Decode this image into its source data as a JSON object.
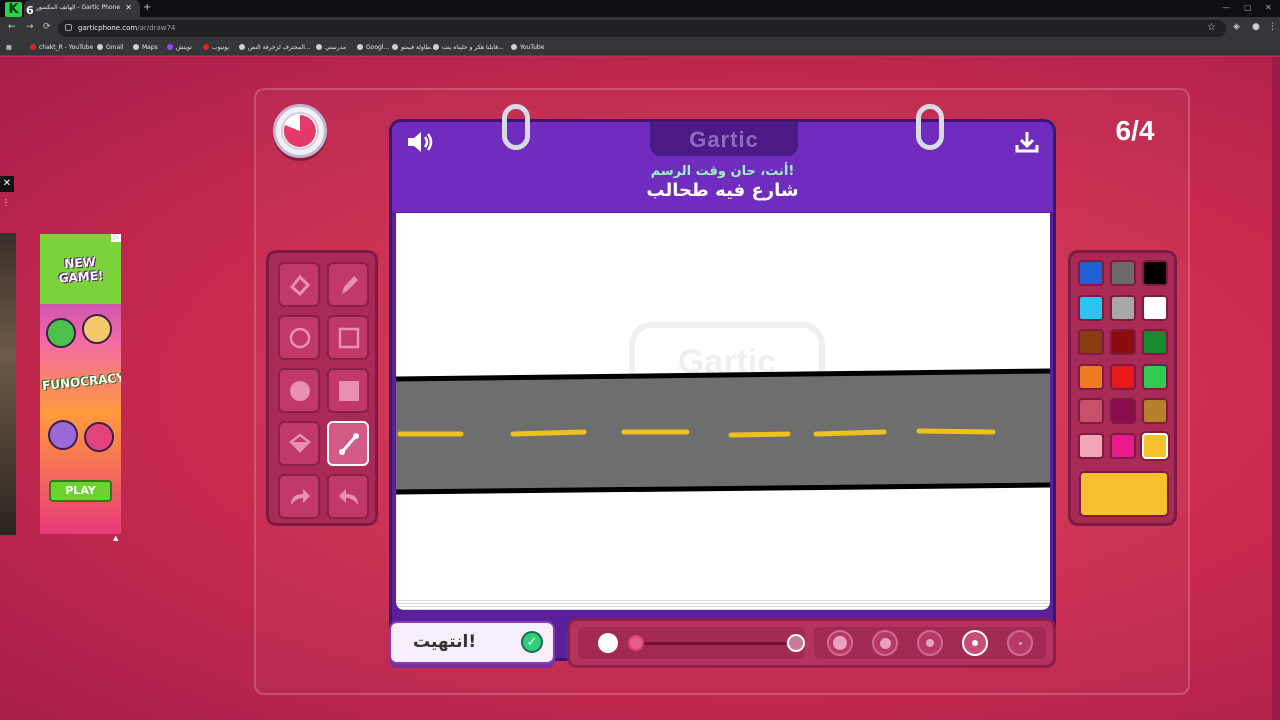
{
  "browser": {
    "tab_title": "الهاتف المكسور - Gartic Phone",
    "url_host": "garticphone.com",
    "url_path": "/ar/draw74",
    "bookmarks": [
      "chakt_R - YouTube",
      "Gmail",
      "Maps",
      "تويتش",
      "يوتيوب",
      "المحترف لزخرفة النص...",
      "مدرستي",
      "Googl...",
      "طاولة فيمتو...",
      "قابلنا هكر و خليناه ينت...",
      "YouTube"
    ],
    "extension_badge": "6"
  },
  "ad": {
    "headline": "NEW GAME!",
    "brand": "FUNOCRACY",
    "cta": "PLAY"
  },
  "game": {
    "brand": "Gartic",
    "round": "6/4",
    "prompt_hint": "أنت، حان وقت الرسم!",
    "prompt": "شارع فيه طحالب",
    "done_label": "انتهيت!",
    "brush_sizes": 5,
    "selected_size_index": 3
  },
  "tools": [
    {
      "name": "eraser-tool",
      "icon": "eraser-icon"
    },
    {
      "name": "pencil-tool",
      "icon": "pencil-icon"
    },
    {
      "name": "ellipse-outline-tool",
      "icon": "circle-outline-icon"
    },
    {
      "name": "rect-outline-tool",
      "icon": "square-outline-icon"
    },
    {
      "name": "ellipse-fill-tool",
      "icon": "circle-fill-icon"
    },
    {
      "name": "rect-fill-tool",
      "icon": "square-fill-icon"
    },
    {
      "name": "bucket-tool",
      "icon": "paint-bucket-icon"
    },
    {
      "name": "line-tool",
      "icon": "line-icon",
      "active": true
    },
    {
      "name": "redo-tool",
      "icon": "redo-icon"
    },
    {
      "name": "undo-tool",
      "icon": "undo-icon"
    }
  ],
  "palette": {
    "colors": [
      "#1f5fd6",
      "#6b6b6b",
      "#000000",
      "#2bc4f2",
      "#a8a8a8",
      "#ffffff",
      "#8c3d14",
      "#8a0c0c",
      "#178a2f",
      "#f07a22",
      "#e81919",
      "#2fcb4e",
      "#c7506b",
      "#8a0e4d",
      "#b7802a",
      "#f2a3b5",
      "#ea1a8c",
      "#f6c02e"
    ],
    "selected_index": 17,
    "current": "#f6c02e"
  },
  "drawing": {
    "road_color": "#6e6e6e",
    "edge_color": "#000000",
    "lane_color": "#f0c021",
    "watermark": "Gartic"
  }
}
